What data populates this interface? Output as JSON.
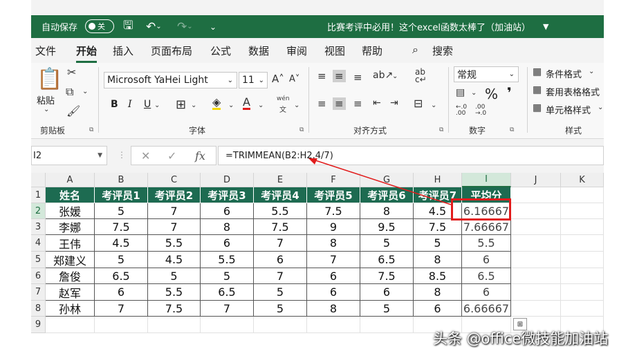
{
  "titlebar": {
    "autosave": "自动保存",
    "toggle": "关",
    "title": "比赛考评中必用！这个excel函数太棒了（加油站）"
  },
  "menu": {
    "tabs": [
      "文件",
      "开始",
      "插入",
      "页面布局",
      "公式",
      "数据",
      "审阅",
      "视图",
      "帮助"
    ],
    "search": "搜索"
  },
  "ribbon": {
    "clipboard": {
      "paste": "粘贴",
      "label": "剪贴板"
    },
    "font": {
      "name": "Microsoft YaHei Light",
      "size": "11",
      "label": "字体",
      "bold": "B",
      "italic": "I",
      "underline": "U",
      "wen": "wén",
      "wen_sub": "文"
    },
    "alignment": {
      "label": "对齐方式"
    },
    "number": {
      "format": "常规",
      "label": "数字",
      "percent": "%",
      "comma": "❜"
    },
    "styles": {
      "conditional": "条件格式",
      "table": "套用表格格式",
      "cell": "单元格样式",
      "label": "样式"
    }
  },
  "formula_bar": {
    "name_box": "I2",
    "fx": "fx",
    "formula": "=TRIMMEAN(B2:H2,4/7)"
  },
  "sheet": {
    "columns": [
      "A",
      "B",
      "C",
      "D",
      "E",
      "F",
      "G",
      "H",
      "I",
      "J",
      "K"
    ],
    "rows": [
      "1",
      "2",
      "3",
      "4",
      "5",
      "6",
      "7",
      "8",
      "9"
    ],
    "header": [
      "姓名",
      "考评员1",
      "考评员2",
      "考评员3",
      "考评员4",
      "考评员5",
      "考评员6",
      "考评员7",
      "平均分"
    ],
    "data": [
      [
        "张媛",
        "5",
        "7",
        "6",
        "5.5",
        "7.5",
        "8",
        "4.5",
        "6.16667"
      ],
      [
        "李娜",
        "7.5",
        "7",
        "8",
        "7.5",
        "9",
        "9.5",
        "7.5",
        "7.66667"
      ],
      [
        "王伟",
        "4.5",
        "5.5",
        "6",
        "7",
        "8",
        "5",
        "5",
        "5.5"
      ],
      [
        "郑建义",
        "5",
        "4.5",
        "5.5",
        "6",
        "7",
        "6.5",
        "8",
        "6"
      ],
      [
        "詹俊",
        "6.5",
        "5",
        "5",
        "7",
        "6",
        "7.5",
        "8.5",
        "6.5"
      ],
      [
        "赵军",
        "6",
        "5.5",
        "6.5",
        "5",
        "6",
        "6",
        "8",
        "6"
      ],
      [
        "孙林",
        "7",
        "7.5",
        "7",
        "5",
        "8",
        "5",
        "6",
        "6.66667"
      ]
    ]
  },
  "watermark": "头条 @office微技能加油站",
  "colors": {
    "accent": "#1e6e42",
    "header_fill": "#1d6b51",
    "highlight": "#e11b1b"
  }
}
